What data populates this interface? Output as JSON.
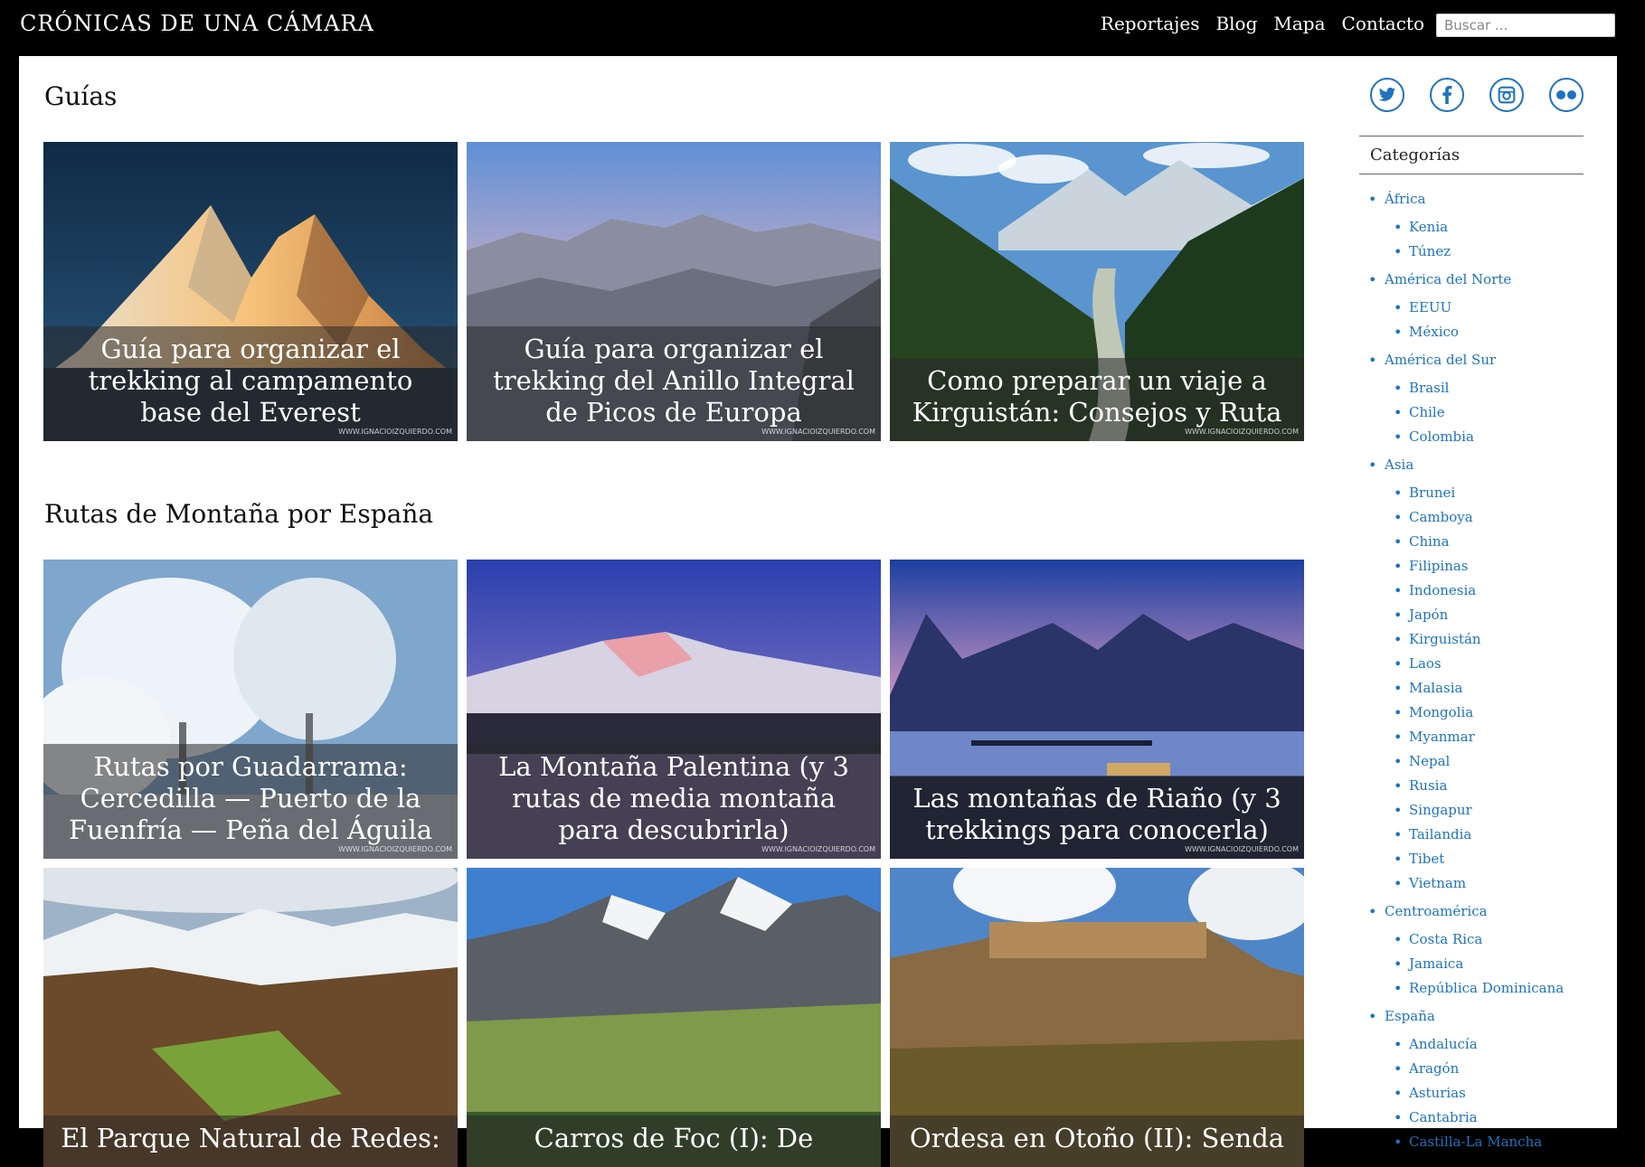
{
  "header": {
    "brand": "CRÓNICAS DE UNA CÁMARA",
    "nav": [
      "Reportajes",
      "Blog",
      "Mapa",
      "Contacto"
    ],
    "search_placeholder": "Buscar ..."
  },
  "sections": [
    {
      "title": "Guías",
      "cards": [
        {
          "caption": "Guía para organizar el trekking al campamento base del Everest",
          "watermark": "WWW.IGNACIOIZQUIERDO.COM"
        },
        {
          "caption": "Guía para organizar el trekking del Anillo Integral de Picos de Europa",
          "watermark": "WWW.IGNACIOIZQUIERDO.COM"
        },
        {
          "caption": "Como preparar un viaje a Kirguistán: Consejos y Ruta",
          "watermark": "WWW.IGNACIOIZQUIERDO.COM"
        }
      ]
    },
    {
      "title": "Rutas de Montaña por España",
      "cards": [
        {
          "caption": "Rutas por Guadarrama: Cercedilla — Puerto de la Fuenfría — Peña del Águila",
          "watermark": "WWW.IGNACIOIZQUIERDO.COM"
        },
        {
          "caption": "La Montaña Palentina (y 3 rutas de media montaña para descubrirla)",
          "watermark": "WWW.IGNACIOIZQUIERDO.COM"
        },
        {
          "caption": "Las montañas de Riaño (y 3 trekkings para conocerla)",
          "watermark": "WWW.IGNACIOIZQUIERDO.COM"
        },
        {
          "caption": "El Parque Natural de Redes:",
          "watermark": ""
        },
        {
          "caption": "Carros de Foc (I): De",
          "watermark": ""
        },
        {
          "caption": "Ordesa en Otoño (II): Senda",
          "watermark": ""
        }
      ]
    }
  ],
  "sidebar": {
    "social": [
      "twitter-icon",
      "facebook-icon",
      "instagram-icon",
      "flickr-icon"
    ],
    "categories_title": "Categorías",
    "categories": [
      {
        "name": "África",
        "children": [
          "Kenia",
          "Túnez"
        ]
      },
      {
        "name": "América del Norte",
        "children": [
          "EEUU",
          "México"
        ]
      },
      {
        "name": "América del Sur",
        "children": [
          "Brasil",
          "Chile",
          "Colombia"
        ]
      },
      {
        "name": "Asia",
        "children": [
          "Brunei",
          "Camboya",
          "China",
          "Filipinas",
          "Indonesia",
          "Japón",
          "Kirguistán",
          "Laos",
          "Malasia",
          "Mongolia",
          "Myanmar",
          "Nepal",
          "Rusia",
          "Singapur",
          "Tailandia",
          "Tibet",
          "Vietnam"
        ]
      },
      {
        "name": "Centroamérica",
        "children": [
          "Costa Rica",
          "Jamaica",
          "República Dominicana"
        ]
      },
      {
        "name": "España",
        "children": [
          "Andalucía",
          "Aragón",
          "Asturias",
          "Cantabria",
          "Castilla-La Mancha"
        ]
      }
    ],
    "accent_color": "#1e73be"
  }
}
